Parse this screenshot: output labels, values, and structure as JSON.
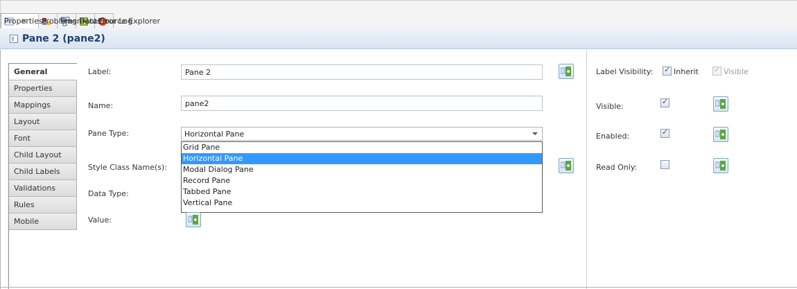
{
  "tabs": [
    {
      "label": "Properties",
      "icon": "properties-icon",
      "active": true,
      "close": "✕"
    },
    {
      "label": "Problems",
      "icon": "problems-icon"
    },
    {
      "label": "Fragments",
      "icon": "fragments-icon"
    },
    {
      "label": "Data Source Explorer",
      "icon": "data-source-icon"
    },
    {
      "label": "Error Log",
      "icon": "error-log-icon"
    }
  ],
  "header": {
    "title": "Pane 2 (pane2)"
  },
  "categories": [
    "General",
    "Properties",
    "Mappings",
    "Layout",
    "Font",
    "Child Layout",
    "Child Labels",
    "Validations",
    "Rules",
    "Mobile"
  ],
  "form": {
    "label_label": "Label:",
    "label_value": "Pane 2",
    "name_label": "Name:",
    "name_value": "pane2",
    "pane_type_label": "Pane Type:",
    "pane_type_value": "Horizontal Pane",
    "style_class_label": "Style Class Name(s):",
    "data_type_label": "Data Type:",
    "value_label": "Value:"
  },
  "dropdown": {
    "options": [
      "Grid Pane",
      "Horizontal Pane",
      "Modal Dialog Pane",
      "Record Pane",
      "Tabbed Pane",
      "Vertical Pane"
    ],
    "highlighted": "Horizontal Pane"
  },
  "right": {
    "label_visibility_label": "Label Visibility:",
    "inherit_label": "Inherit",
    "visible_label": "Visible",
    "visible_field_label": "Visible:",
    "enabled_label": "Enabled:",
    "read_only_label": "Read Only:"
  },
  "colors": {
    "header_title": "#1d3f6e",
    "highlight": "#3399ff"
  }
}
